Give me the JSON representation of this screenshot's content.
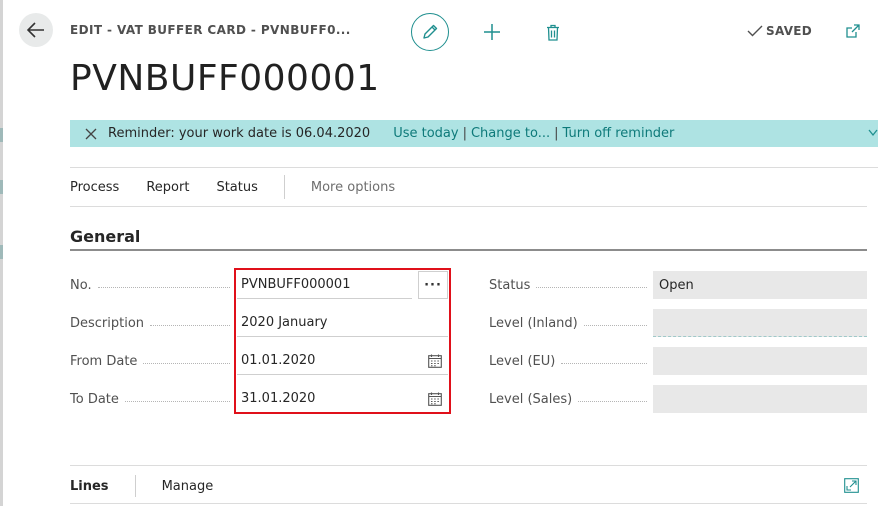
{
  "header": {
    "breadcrumb": "EDIT - VAT BUFFER CARD - PVNBUFF0...",
    "title": "PVNBUFF000001",
    "saved_label": "SAVED",
    "icons": [
      "back-arrow-icon",
      "pencil-icon",
      "plus-icon",
      "trash-icon",
      "checkmark-icon",
      "popout-icon"
    ]
  },
  "reminder": {
    "message": "Reminder: your work date is 06.04.2020",
    "use_today": "Use today",
    "change_to": "Change to...",
    "turn_off": "Turn off reminder",
    "separator": "|",
    "color": "#aee3e3"
  },
  "actions": {
    "process": "Process",
    "report": "Report",
    "status": "Status",
    "more": "More options"
  },
  "general": {
    "title": "General",
    "no_label": "No.",
    "no_value": "PVNBUFF000001",
    "lookup_label": "···",
    "description_label": "Description",
    "description_value": "2020 January",
    "from_date_label": "From Date",
    "from_date_value": "01.01.2020",
    "to_date_label": "To Date",
    "to_date_value": "31.01.2020",
    "status_label": "Status",
    "status_value": "Open",
    "level_inland_label": "Level (Inland)",
    "level_inland_value": "",
    "level_eu_label": "Level (EU)",
    "level_eu_value": "",
    "level_sales_label": "Level (Sales)",
    "level_sales_value": ""
  },
  "lines": {
    "lines_label": "Lines",
    "manage_label": "Manage"
  },
  "colors": {
    "accent": "#1f8f8f",
    "highlight_box": "#e0101a"
  }
}
